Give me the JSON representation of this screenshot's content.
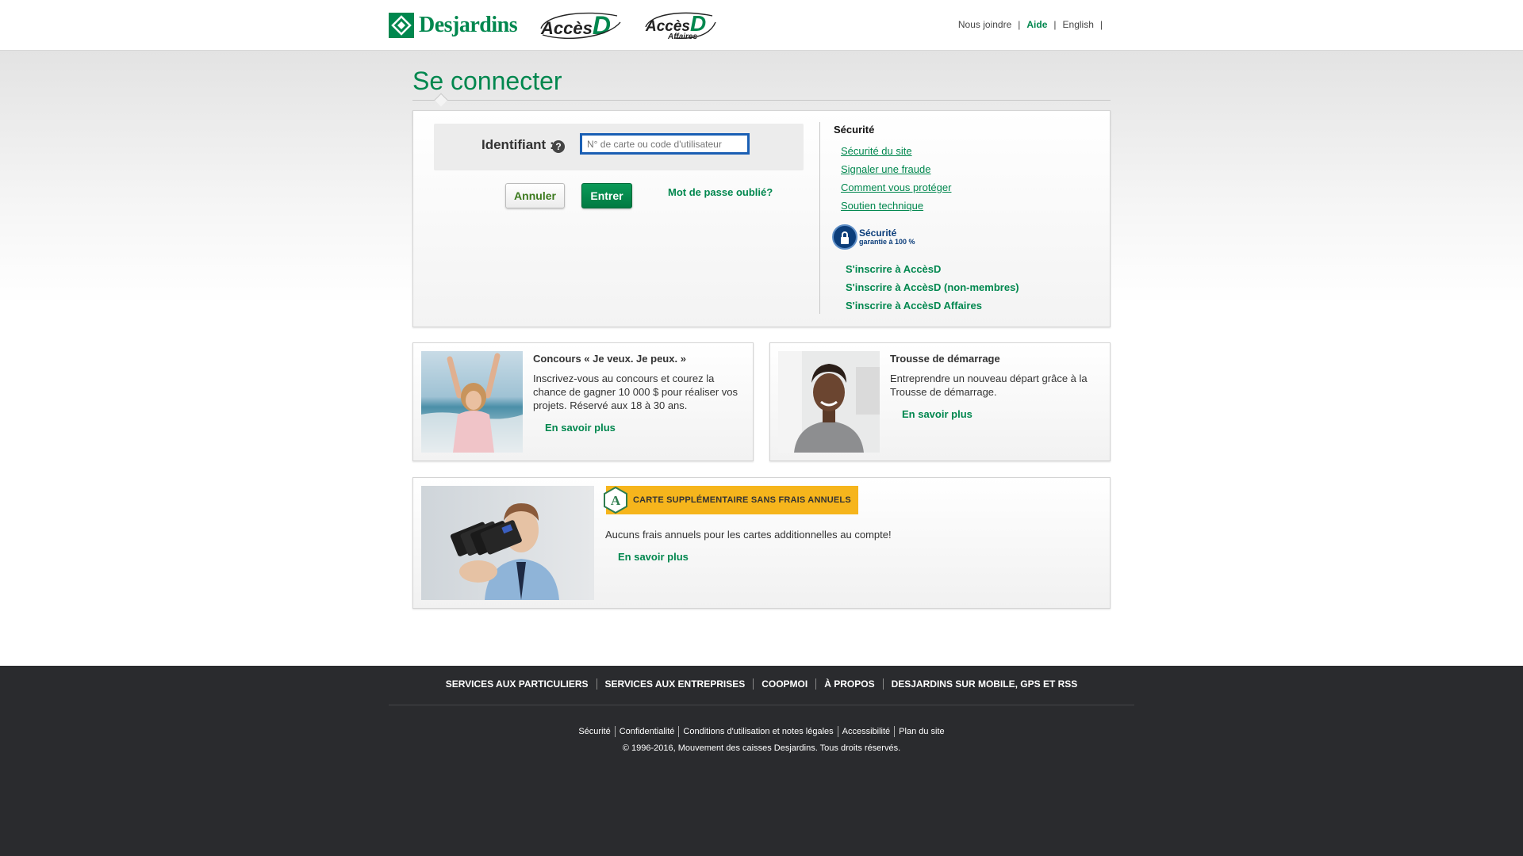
{
  "header": {
    "brand": "Desjardins",
    "acces_d": {
      "word": "Accès",
      "letter": "D"
    },
    "acces_d_affaires": {
      "word": "Accès",
      "letter": "D",
      "sub": "Affaires"
    },
    "links": {
      "contact": "Nous joindre",
      "help": "Aide",
      "lang": "English",
      "sep": "|"
    }
  },
  "page": {
    "title": "Se connecter"
  },
  "login": {
    "id_label": "Identifiant :",
    "help_glyph": "?",
    "id_placeholder": "N° de carte ou code d'utilisateur",
    "cancel_label": "Annuler",
    "enter_label": "Entrer",
    "forgot_label": "Mot de passe oublié?"
  },
  "security": {
    "title": "Sécurité",
    "links": [
      "Sécurité du site",
      "Signaler une fraude",
      "Comment vous protéger",
      "Soutien technique"
    ],
    "guarantee_line1": "Sécurité",
    "guarantee_line2": "garantie à 100 %",
    "register_links": [
      "S'inscrire à AccèsD",
      "S'inscrire à AccèsD (non-membres)",
      "S'inscrire à AccèsD Affaires"
    ]
  },
  "promos": [
    {
      "title": "Concours « Je veux. Je peux. »",
      "text": "Inscrivez-vous au concours et courez la chance de gagner 10 000 $ pour réaliser vos projets. Réservé aux 18 à 30 ans.",
      "link": "En savoir plus"
    },
    {
      "title": "Trousse de démarrage",
      "text": "Entreprendre un nouveau départ grâce à la Trousse de démarrage.",
      "link": "En savoir plus"
    }
  ],
  "card_promo": {
    "badge_letter": "A",
    "banner": "CARTE SUPPLÉMENTAIRE SANS FRAIS ANNUELS",
    "text": "Aucuns frais annuels pour les cartes additionnelles au compte!",
    "link": "En savoir plus"
  },
  "footer": {
    "nav": [
      "SERVICES AUX PARTICULIERS",
      "SERVICES AUX ENTREPRISES",
      "COOPMOI",
      "À PROPOS",
      "DESJARDINS SUR MOBILE, GPS ET RSS"
    ],
    "links": [
      "Sécurité",
      "Confidentialité",
      "Conditions d'utilisation et notes légales",
      "Accessibilité",
      "Plan du site"
    ],
    "copyright": "© 1996-2016, Mouvement des caisses Desjardins. Tous droits réservés."
  },
  "colors": {
    "brand_green": "#00874e",
    "banner_yellow": "#f6b51c",
    "footer_bg": "#2a2b2e",
    "input_focus": "#1a5fb4"
  }
}
